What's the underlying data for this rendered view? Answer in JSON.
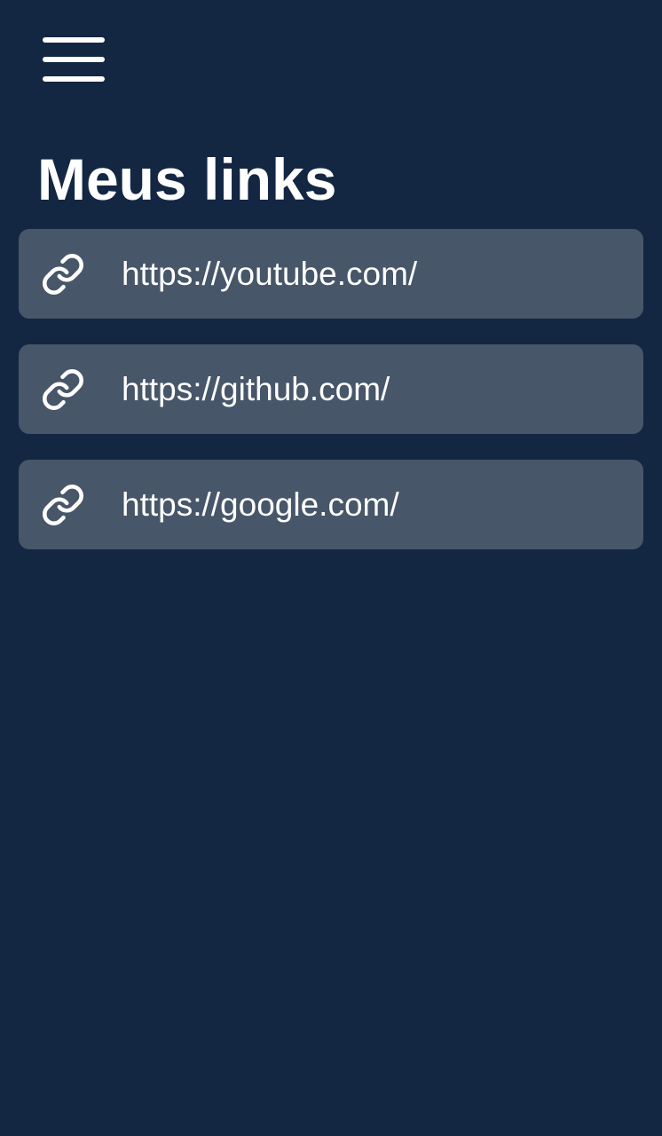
{
  "header": {
    "menu_icon": "hamburger-menu-icon"
  },
  "page": {
    "title": "Meus links"
  },
  "links": [
    {
      "url": "https://youtube.com/",
      "icon": "link-icon"
    },
    {
      "url": "https://github.com/",
      "icon": "link-icon"
    },
    {
      "url": "https://google.com/",
      "icon": "link-icon"
    }
  ],
  "colors": {
    "background": "#132742",
    "card": "#475669",
    "text": "#ffffff"
  }
}
